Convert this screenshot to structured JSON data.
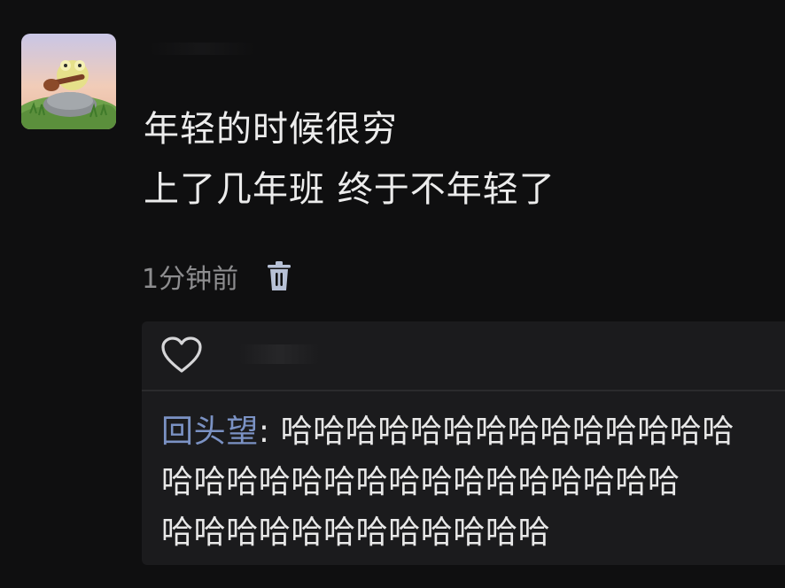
{
  "post": {
    "text_line1": "年轻的时候很穷",
    "text_line2": "上了几年班 终于不年轻了",
    "time": "1分钟前"
  },
  "icons": {
    "avatar": "frog-with-guitar-avatar",
    "delete": "trash-icon",
    "like": "heart-outline-icon"
  },
  "comment": {
    "author": "回头望",
    "separator": ": ",
    "line1": "哈哈哈哈哈哈哈哈哈哈哈哈哈哈",
    "line2": "哈哈哈哈哈哈哈哈哈哈哈哈哈哈哈哈",
    "line3": "哈哈哈哈哈哈哈哈哈哈哈哈"
  },
  "colors": {
    "background": "#0f0f10",
    "panel": "#1b1b1d",
    "text": "#ececec",
    "muted": "#8d8d8f",
    "link": "#7b92c4"
  }
}
